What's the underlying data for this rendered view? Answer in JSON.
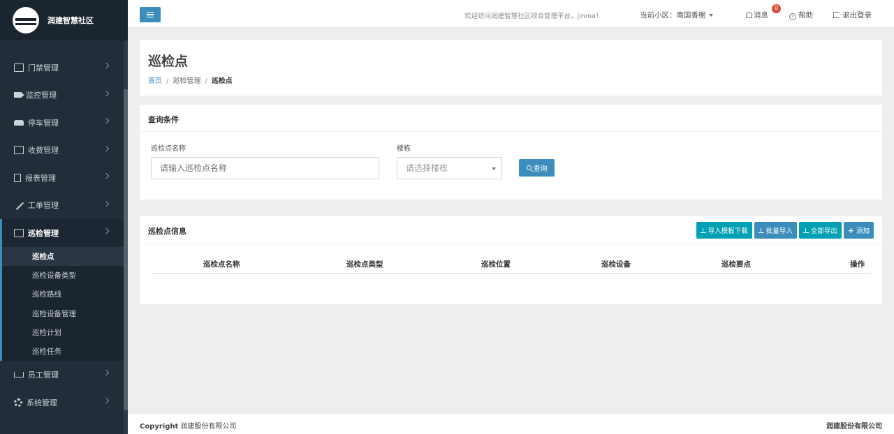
{
  "app": {
    "logo_text": "润建智慧社区"
  },
  "sidebar": {
    "items": [
      {
        "label": "门禁管理",
        "icon": "id-card-icon"
      },
      {
        "label": "监控管理",
        "icon": "video-camera-icon"
      },
      {
        "label": "停车管理",
        "icon": "car-icon"
      },
      {
        "label": "收费管理",
        "icon": "money-icon"
      },
      {
        "label": "报表管理",
        "icon": "report-icon"
      },
      {
        "label": "工单管理",
        "icon": "wrench-icon"
      },
      {
        "label": "巡检管理",
        "icon": "calendar-check-icon"
      },
      {
        "label": "员工管理",
        "icon": "org-tree-icon"
      },
      {
        "label": "系统管理",
        "icon": "gear-icon"
      }
    ],
    "submenu": [
      "巡检点",
      "巡检设备类型",
      "巡检路线",
      "巡检设备管理",
      "巡检计划",
      "巡检任务"
    ],
    "active_submenu": "巡检点"
  },
  "topbar": {
    "welcome": "欢迎访问润建智慧社区综合管理平台，jinma！",
    "community_label": "当前小区：南国香榭",
    "messages_label": "消息",
    "messages_count": "0",
    "help_label": "帮助",
    "logout_label": "退出登录"
  },
  "page": {
    "title": "巡检点",
    "breadcrumb": {
      "home": "首页",
      "parent": "巡检管理",
      "current": "巡检点"
    }
  },
  "query": {
    "title": "查询条件",
    "name_label": "巡检点名称",
    "name_placeholder": "请输入巡检点名称",
    "building_label": "楼栋",
    "building_placeholder": "请选择楼栋",
    "search_button": "查询"
  },
  "table": {
    "title": "巡检点信息",
    "buttons": {
      "template_download": "导入模板下载",
      "batch_import": "批量导入",
      "export_all": "全部导出",
      "add": "添加"
    },
    "columns": [
      "巡检点名称",
      "巡检点类型",
      "巡检位置",
      "巡检设备",
      "巡检要点",
      "操作"
    ]
  },
  "footer": {
    "copyright_prefix": "Copyright",
    "copyright_company": "润建股份有限公司",
    "right_text": "润建股份有限公司"
  },
  "colors": {
    "sidebar_bg": "#222d3a",
    "primary": "#3c8dbc",
    "teal": "#00a1b5",
    "badge": "#dd4b39"
  }
}
